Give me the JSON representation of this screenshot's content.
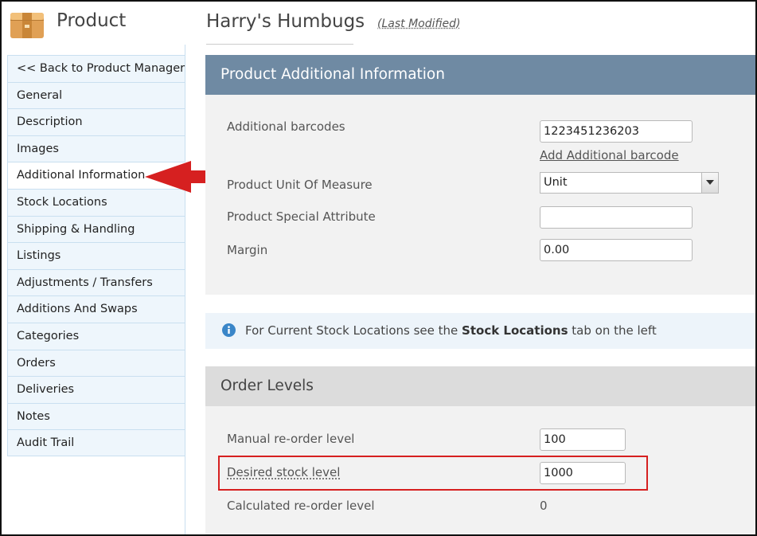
{
  "header": {
    "app_title": "Product",
    "product_name": "Harry's Humbugs",
    "last_modified": "(Last Modified)"
  },
  "sidebar": {
    "items": [
      {
        "label": "<< Back to Product Manager"
      },
      {
        "label": "General"
      },
      {
        "label": "Description"
      },
      {
        "label": "Images"
      },
      {
        "label": "Additional Information",
        "active": true
      },
      {
        "label": "Stock Locations"
      },
      {
        "label": "Shipping & Handling"
      },
      {
        "label": "Listings"
      },
      {
        "label": "Adjustments / Transfers"
      },
      {
        "label": "Additions And Swaps"
      },
      {
        "label": "Categories"
      },
      {
        "label": "Orders"
      },
      {
        "label": "Deliveries"
      },
      {
        "label": "Notes"
      },
      {
        "label": "Audit Trail"
      }
    ]
  },
  "additional_info": {
    "title": "Product Additional Information",
    "barcodes_label": "Additional barcodes",
    "barcode_value": "1223451236203",
    "add_barcode_link": "Add Additional barcode",
    "uom_label": "Product Unit Of Measure",
    "uom_value": "Unit",
    "special_attr_label": "Product Special Attribute",
    "special_attr_value": "",
    "margin_label": "Margin",
    "margin_value": "0.00"
  },
  "info_banner": {
    "text_before": "For Current Stock Locations see the ",
    "text_bold": "Stock Locations",
    "text_after": " tab on the left"
  },
  "order_levels": {
    "title": "Order Levels",
    "manual_label": "Manual re-order level",
    "manual_value": "100",
    "desired_label": "Desired stock level",
    "desired_value": "1000",
    "calculated_label": "Calculated re-order level",
    "calculated_value": "0"
  },
  "colors": {
    "panel_header": "#6f8aa3",
    "annotation_red": "#d62020",
    "info_icon": "#3a86c8"
  }
}
